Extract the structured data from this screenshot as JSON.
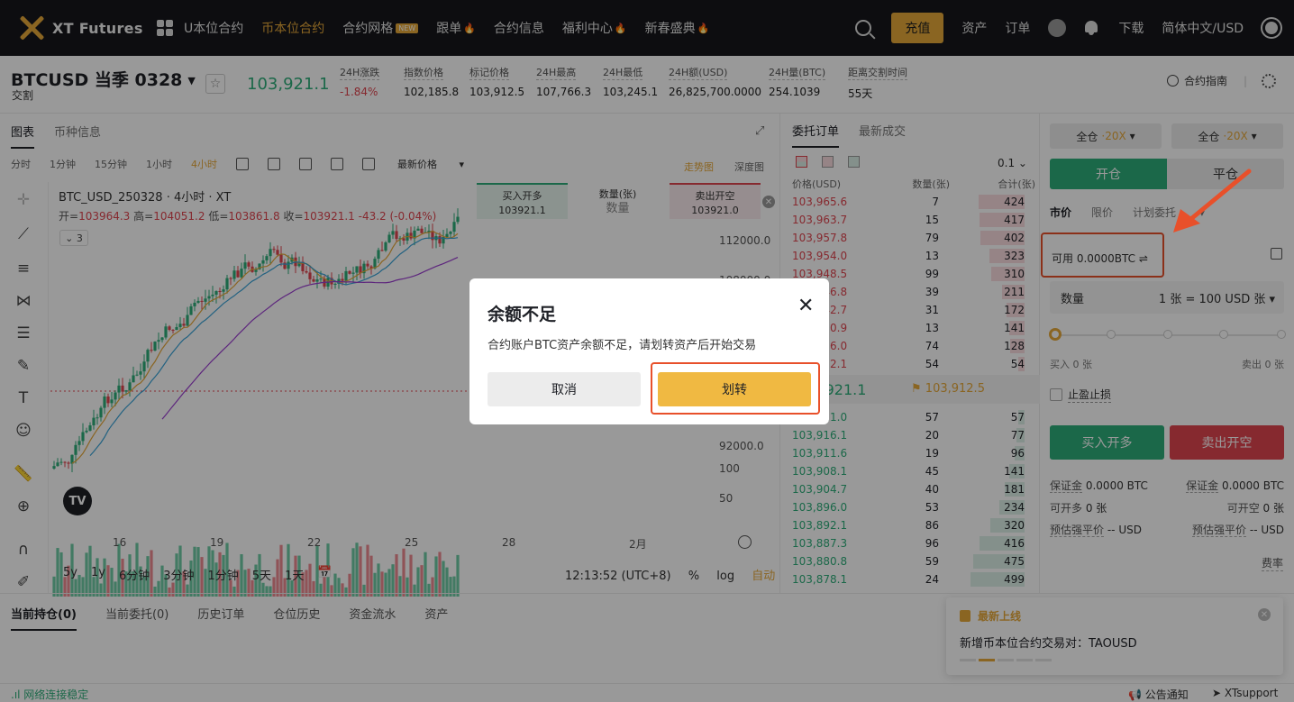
{
  "nav": {
    "brand": "XT Futures",
    "menu": [
      {
        "label": "U本位合约",
        "active": false,
        "tag": "",
        "fire": false
      },
      {
        "label": "币本位合约",
        "active": true,
        "tag": "",
        "fire": false
      },
      {
        "label": "合约网格",
        "active": false,
        "tag": "NEW",
        "fire": false
      },
      {
        "label": "跟单",
        "active": false,
        "tag": "",
        "fire": true
      },
      {
        "label": "合约信息",
        "active": false,
        "tag": "",
        "fire": false
      },
      {
        "label": "福利中心",
        "active": false,
        "tag": "",
        "fire": true
      },
      {
        "label": "新春盛典",
        "active": false,
        "tag": "",
        "fire": true
      }
    ],
    "deposit": "充值",
    "assets": "资产",
    "orders": "订单",
    "download": "下载",
    "language": "简体中文/USD"
  },
  "ticker": {
    "symbol": "BTCUSD 当季 0328",
    "subtitle": "交割",
    "last_price": "103,921.1",
    "stats": [
      {
        "label": "24H涨跌",
        "value": "-1.84%",
        "red": true
      },
      {
        "label": "指数价格",
        "value": "102,185.8",
        "red": false
      },
      {
        "label": "标记价格",
        "value": "103,912.5",
        "red": false
      },
      {
        "label": "24H最高",
        "value": "107,766.3",
        "red": false
      },
      {
        "label": "24H最低",
        "value": "103,245.1",
        "red": false
      },
      {
        "label": "24H额(USD)",
        "value": "26,825,700.0000",
        "red": false
      },
      {
        "label": "24H量(BTC)",
        "value": "254.1039",
        "red": false
      },
      {
        "label": "距离交割时间",
        "value": "55天",
        "red": false
      }
    ],
    "guide": "合约指南"
  },
  "chart": {
    "tabs": [
      "图表",
      "币种信息"
    ],
    "timeframes": [
      "分时",
      "1分钟",
      "15分钟",
      "1小时",
      "4小时"
    ],
    "active_timeframe": "4小时",
    "price_type": "最新价格",
    "view_trend": "走势图",
    "view_depth": "深度图",
    "title": "BTC_USD_250328 · 4小时 · XT",
    "ohlc": {
      "o_label": "开=",
      "o": "103964.3",
      "h_label": "高=",
      "h": "104051.2",
      "l_label": "低=",
      "l": "103861.8",
      "c_label": "收=",
      "c": "103921.1",
      "chg": "-43.2 (-0.04%)"
    },
    "collapse_count": "3",
    "buy_open_label": "买入开多",
    "buy_open_price": "103921.1",
    "qty_label": "数量(张)",
    "qty_value": "数量",
    "sell_open_label": "卖出开空",
    "sell_open_price": "103921.0",
    "range_buttons": [
      "5y",
      "1y",
      "6分钟",
      "3分钟",
      "1分钟",
      "5天",
      "1天"
    ],
    "clock": "12:13:52 (UTC+8)",
    "pct": "%",
    "log": "log",
    "auto": "自动",
    "tv_logo": "TV"
  },
  "chart_data": {
    "type": "candlestick",
    "y_ticks": [
      "112000.0",
      "108000.0",
      "92000.0"
    ],
    "volume_ticks": [
      "100",
      "50"
    ],
    "x_ticks": [
      "16",
      "19",
      "22",
      "25",
      "28",
      "2月"
    ]
  },
  "orderbook": {
    "tabs": [
      "委托订单",
      "最新成交"
    ],
    "precision": "0.1",
    "headers": {
      "price": "价格(USD)",
      "qty": "数量(张)",
      "total": "合计(张)"
    },
    "asks": [
      {
        "p": "103,965.6",
        "q": "7",
        "t": "424",
        "f": 0.85
      },
      {
        "p": "103,963.7",
        "q": "15",
        "t": "417",
        "f": 0.84
      },
      {
        "p": "103,957.8",
        "q": "79",
        "t": "402",
        "f": 0.81
      },
      {
        "p": "103,954.0",
        "q": "13",
        "t": "323",
        "f": 0.65
      },
      {
        "p": "103,948.5",
        "q": "99",
        "t": "310",
        "f": 0.62
      },
      {
        "p": "103,946.8",
        "q": "39",
        "t": "211",
        "f": 0.42
      },
      {
        "p": "103,942.7",
        "q": "31",
        "t": "172",
        "f": 0.34
      },
      {
        "p": "103,930.9",
        "q": "13",
        "t": "141",
        "f": 0.28
      },
      {
        "p": "103,926.0",
        "q": "74",
        "t": "128",
        "f": 0.26
      },
      {
        "p": "103,922.1",
        "q": "54",
        "t": "54",
        "f": 0.11
      }
    ],
    "mid_price": "103,921.1",
    "mark_price": "103,912.5",
    "bids": [
      {
        "p": "103,921.0",
        "q": "57",
        "t": "57",
        "f": 0.11
      },
      {
        "p": "103,916.1",
        "q": "20",
        "t": "77",
        "f": 0.15
      },
      {
        "p": "103,911.6",
        "q": "19",
        "t": "96",
        "f": 0.19
      },
      {
        "p": "103,908.1",
        "q": "45",
        "t": "141",
        "f": 0.28
      },
      {
        "p": "103,904.7",
        "q": "40",
        "t": "181",
        "f": 0.36
      },
      {
        "p": "103,896.0",
        "q": "53",
        "t": "234",
        "f": 0.47
      },
      {
        "p": "103,892.1",
        "q": "86",
        "t": "320",
        "f": 0.64
      },
      {
        "p": "103,887.3",
        "q": "96",
        "t": "416",
        "f": 0.83
      },
      {
        "p": "103,880.8",
        "q": "59",
        "t": "475",
        "f": 0.95
      },
      {
        "p": "103,878.1",
        "q": "24",
        "t": "499",
        "f": 1.0
      }
    ]
  },
  "order": {
    "margin_mode_left": "全仓",
    "leverage_left": "20X",
    "margin_mode_right": "全仓",
    "leverage_right": "20X",
    "open": "开仓",
    "close": "平仓",
    "types": [
      "市价",
      "限价",
      "计划委托"
    ],
    "available": "可用 0.0000BTC ⇌",
    "qty_label": "数量",
    "qty_unit": "1 张 = 100 USD 张 ▾",
    "buy_min": "买入 0 张",
    "sell_max": "卖出 0 张",
    "tpsl": "止盈止损",
    "buy_btn": "买入开多",
    "sell_btn": "卖出开空",
    "margin_l": "保证金",
    "margin_lv": "0.0000 BTC",
    "margin_r": "保证金",
    "margin_rv": "0.0000 BTC",
    "open_long": "可开多",
    "open_long_v": "0 张",
    "open_short": "可开空",
    "open_short_v": "0 张",
    "liq_l": "预估强平价",
    "liq_lv": "-- USD",
    "liq_r": "预估强平价",
    "liq_rv": "-- USD",
    "fee": "费率"
  },
  "bottom": {
    "tabs": [
      "当前持仓(0)",
      "当前委托(0)",
      "历史订单",
      "仓位历史",
      "资金流水",
      "资产"
    ]
  },
  "toast": {
    "title": "最新上线",
    "message": "新增币本位合约交易对：TAOUSD"
  },
  "status": {
    "network": ".ıl 网络连接稳定",
    "announcement": "公告通知",
    "support": "XTsupport"
  },
  "modal": {
    "title": "余额不足",
    "message": "合约账户BTC资产余额不足，请划转资产后开始交易",
    "cancel": "取消",
    "transfer": "划转"
  },
  "colors": {
    "accent": "#e7a83a",
    "up": "#2eae7a",
    "down": "#e0454f",
    "highlight": "#e8502a"
  }
}
